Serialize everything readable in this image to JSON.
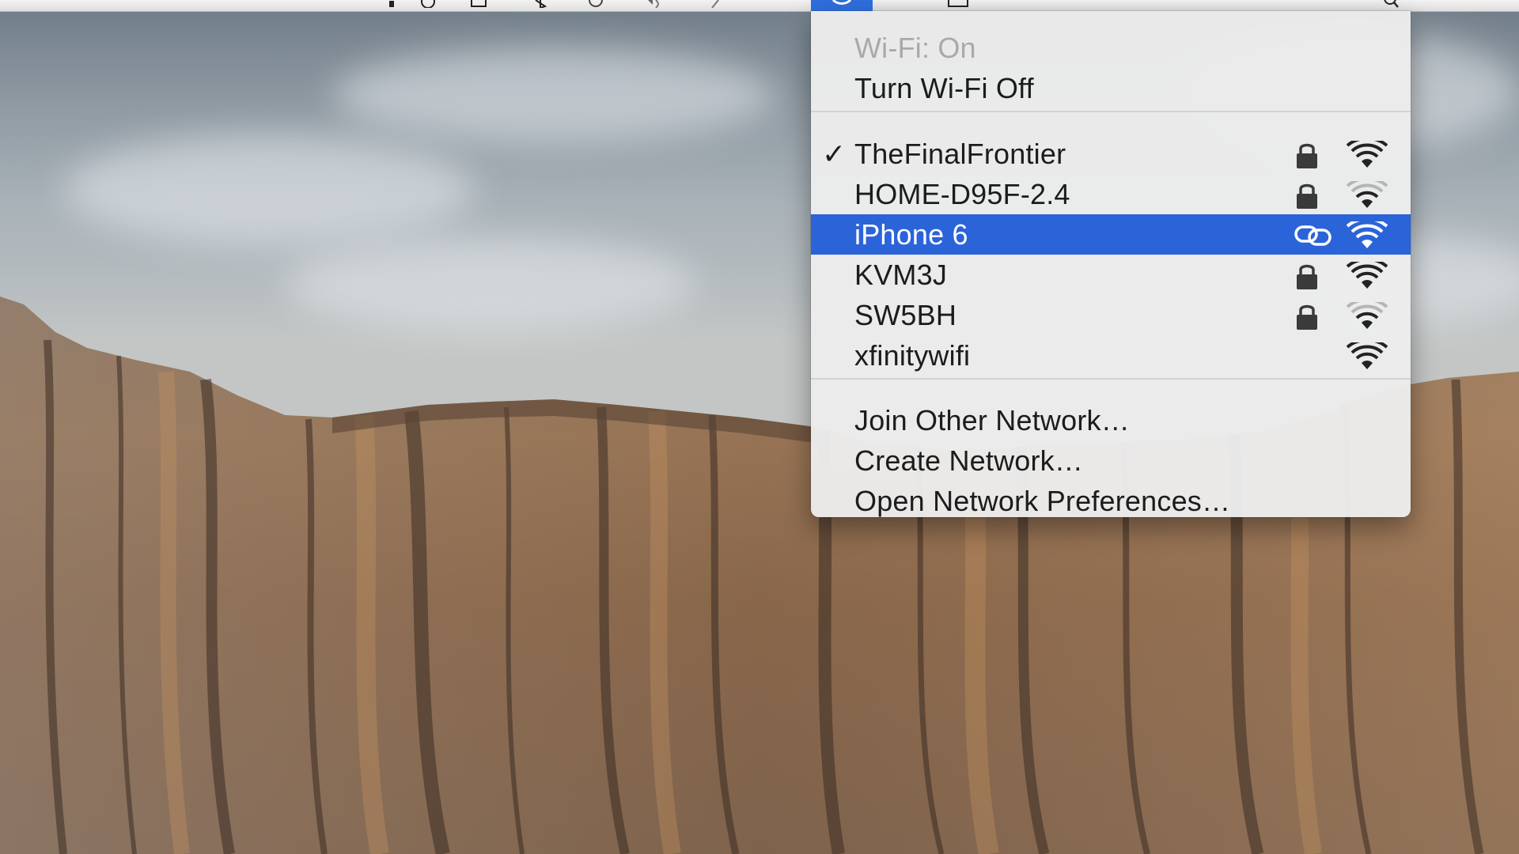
{
  "menubar": {
    "icons": [
      "dropbox-icon",
      "time-machine-icon",
      "airplay-icon",
      "bluetooth-icon",
      "sync-icon",
      "volume-icon",
      "wifi-icon",
      "battery-icon",
      "search-icon"
    ]
  },
  "wifi_menu": {
    "status": "Wi-Fi: On",
    "toggle": "Turn Wi-Fi Off",
    "networks": [
      {
        "name": "TheFinalFrontier",
        "connected": true,
        "secured": true,
        "signal_bars": 4
      },
      {
        "name": "HOME-D95F-2.4",
        "connected": false,
        "secured": true,
        "signal_bars": 2
      },
      {
        "name": "iPhone 6",
        "connected": false,
        "secured": false,
        "personal_hotspot": true,
        "highlighted": true,
        "signal_bars": 4
      },
      {
        "name": "KVM3J",
        "connected": false,
        "secured": true,
        "signal_bars": 4
      },
      {
        "name": "SW5BH",
        "connected": false,
        "secured": true,
        "signal_bars": 2
      },
      {
        "name": "xfinitywifi",
        "connected": false,
        "secured": false,
        "signal_bars": 4
      }
    ],
    "checkmark": "✓",
    "actions": {
      "join_other": "Join Other Network…",
      "create": "Create Network…",
      "preferences": "Open Network Preferences…"
    }
  },
  "colors": {
    "highlight": "#2b63d9",
    "menu_background": "#ececec",
    "disabled_text": "#a9a9a9"
  }
}
